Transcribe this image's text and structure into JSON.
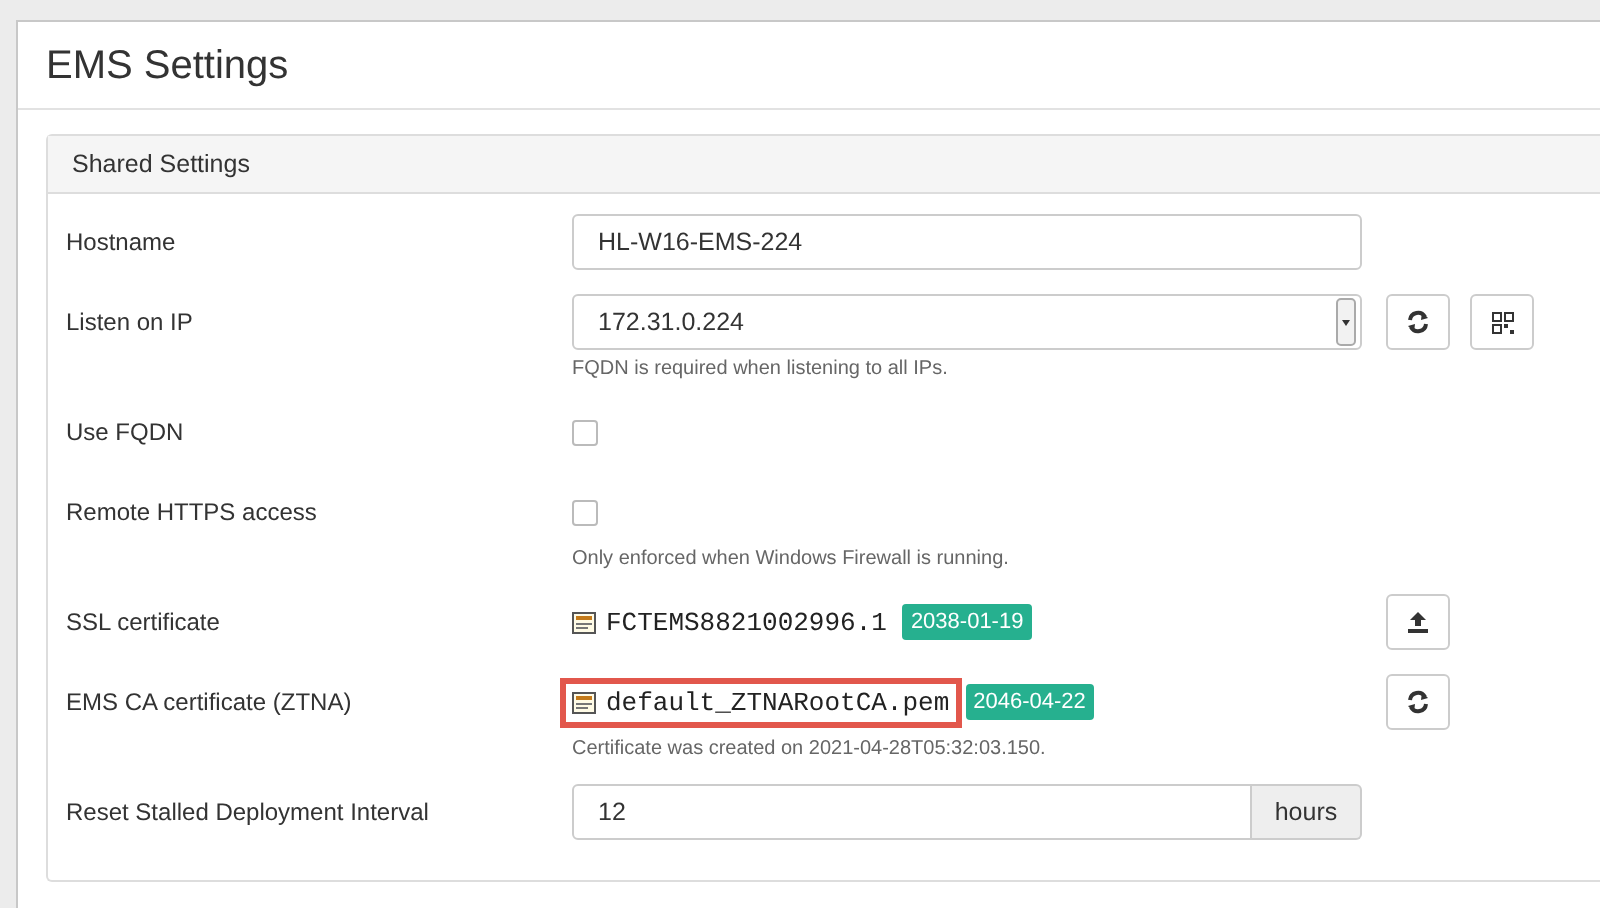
{
  "page": {
    "title": "EMS Settings"
  },
  "panel": {
    "title": "Shared Settings",
    "rows": [
      {
        "label": "Hostname",
        "kind": "text",
        "value": "HL-W16-EMS-224"
      },
      {
        "label": "Listen on IP",
        "kind": "select",
        "value": "172.31.0.224",
        "help": "FQDN is required when listening to all IPs.",
        "buttons": [
          {
            "kind": "refresh"
          },
          {
            "kind": "qr"
          }
        ]
      },
      {
        "label": "Use FQDN",
        "kind": "checkbox",
        "checked": false
      },
      {
        "label": "Remote HTTPS access",
        "kind": "checkbox",
        "checked": false,
        "help": "Only enforced when Windows Firewall is running."
      },
      {
        "label": "SSL certificate",
        "kind": "certificate",
        "file": "FCTEMS8821002996.1",
        "date": "2038-01-19",
        "highlighted": false,
        "buttons": [
          {
            "kind": "upload"
          }
        ]
      },
      {
        "label": "EMS CA certificate (ZTNA)",
        "kind": "certificate",
        "file": "default_ZTNARootCA.pem",
        "date": "2046-04-22",
        "highlighted": true,
        "help": "Certificate was created on 2021-04-28T05:32:03.150.",
        "buttons": [
          {
            "kind": "refresh"
          }
        ]
      },
      {
        "label": "Reset Stalled Deployment Interval",
        "kind": "addon",
        "value": "12",
        "addon": "hours"
      }
    ]
  }
}
